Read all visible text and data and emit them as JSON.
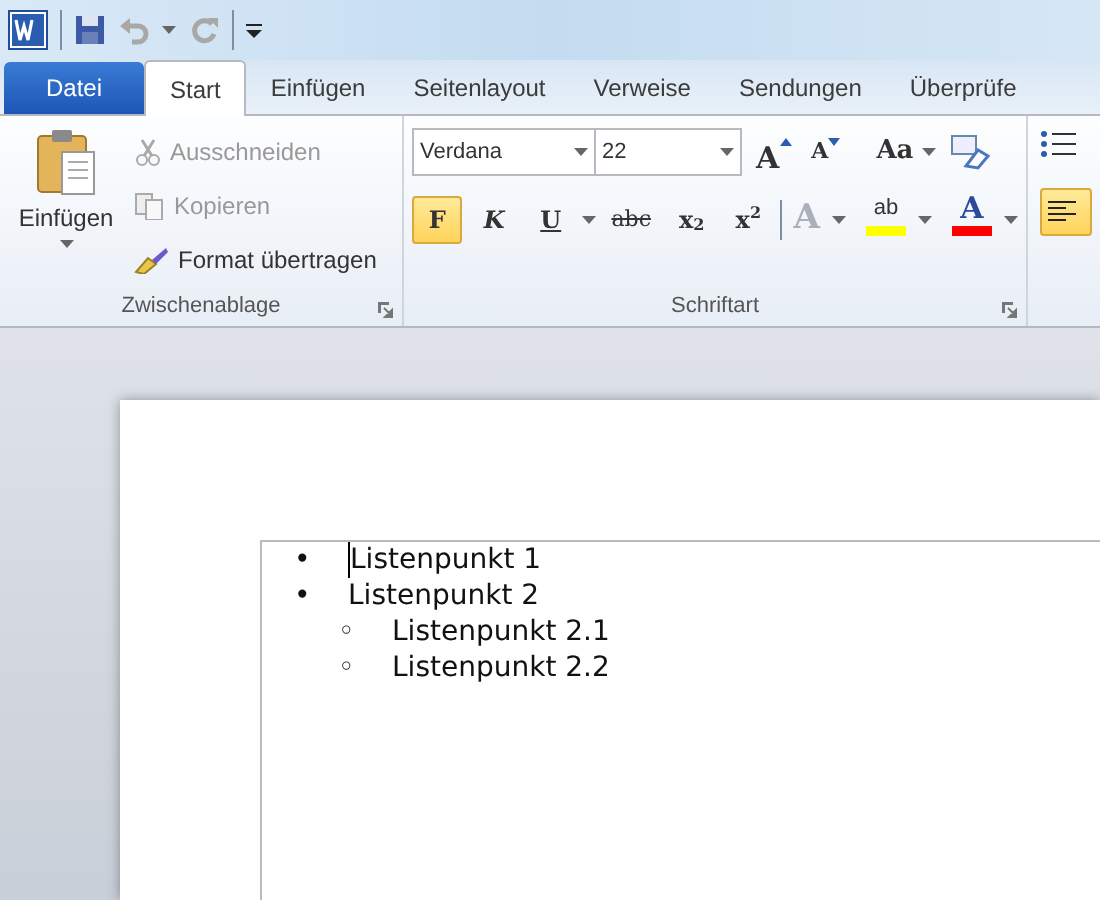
{
  "quick_access": [
    {
      "kind": "save"
    },
    {
      "kind": "undo",
      "disabled": true
    },
    {
      "kind": "redo",
      "disabled": true
    }
  ],
  "tabs": [
    {
      "label": "Datei",
      "kind": "file",
      "selected": false
    },
    {
      "label": "Start",
      "kind": "tab",
      "selected": true
    },
    {
      "label": "Einfügen",
      "kind": "tab",
      "selected": false
    },
    {
      "label": "Seitenlayout",
      "kind": "tab",
      "selected": false
    },
    {
      "label": "Verweise",
      "kind": "tab",
      "selected": false
    },
    {
      "label": "Sendungen",
      "kind": "tab",
      "selected": false
    },
    {
      "label": "Überprüfe",
      "kind": "tab",
      "selected": false
    }
  ],
  "clipboard": {
    "title": "Zwischenablage",
    "paste": "Einfügen",
    "actions": [
      {
        "label": "Ausschneiden",
        "kind": "cut",
        "disabled": true
      },
      {
        "label": "Kopieren",
        "kind": "copy",
        "disabled": true
      },
      {
        "label": "Format übertragen",
        "kind": "brush",
        "disabled": false
      }
    ]
  },
  "font": {
    "title": "Schriftart",
    "family": "Verdana",
    "size": "22",
    "grow": "A",
    "shrink": "A",
    "case": "Aa",
    "buttons": [
      {
        "label": "F",
        "kind": "bold",
        "selected": true
      },
      {
        "label": "K",
        "kind": "italic",
        "selected": false
      },
      {
        "label": "U",
        "kind": "underline",
        "selected": false
      },
      {
        "label": "abc",
        "kind": "strike",
        "selected": false
      },
      {
        "label": "x$_{2}$",
        "kind": "sub",
        "selected": false
      },
      {
        "label": "x$^{2}$",
        "kind": "sup",
        "selected": false
      }
    ],
    "effects": {
      "label": "A",
      "disabled": true
    },
    "highlight": {
      "label": "ab",
      "color": "#ffff00"
    },
    "font_color": {
      "label": "A",
      "color": "#ff0000"
    }
  },
  "paragraph": {
    "align_left_selected": true
  },
  "document": {
    "list": [
      {
        "bullet": "•",
        "text": "Listenpunkt 1"
      },
      {
        "bullet": "•",
        "text": "Listenpunkt 2",
        "children": [
          {
            "bullet": "◦",
            "text": "Listenpunkt 2.1"
          },
          {
            "bullet": "◦",
            "text": "Listenpunkt 2.2"
          }
        ]
      }
    ]
  }
}
